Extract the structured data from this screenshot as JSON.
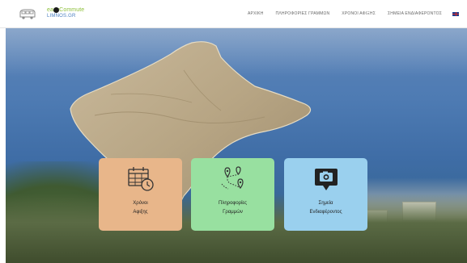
{
  "logo": {
    "line1": "easyCommute",
    "line2": "LIMNOS.GR"
  },
  "nav": {
    "items": [
      {
        "label": "ΑΡΧΙΚΗ"
      },
      {
        "label": "ΠΛΗΡΟΦΟΡΙΕΣ ΓΡΑΜΜΩΝ"
      },
      {
        "label": "ΧΡΟΝΟΙ ΑΦΙΞΗΣ"
      },
      {
        "label": "ΣΗΜΕΙΑ ΕΝΔΙΑΦΕΡΟΝΤΟΣ"
      }
    ],
    "language_flag": "uk-flag-icon"
  },
  "cards": [
    {
      "line1": "Χρόνοι",
      "line2": "Αφιξης",
      "icon": "calendar-clock-icon",
      "color": "#e8b68a"
    },
    {
      "line1": "Πληροφορίες",
      "line2": "Γραμμών",
      "icon": "route-pins-icon",
      "color": "#98e0a0"
    },
    {
      "line1": "Σημεία",
      "line2": "Ενδιαφέροντος",
      "icon": "camera-pin-icon",
      "color": "#9ad0ee"
    }
  ]
}
